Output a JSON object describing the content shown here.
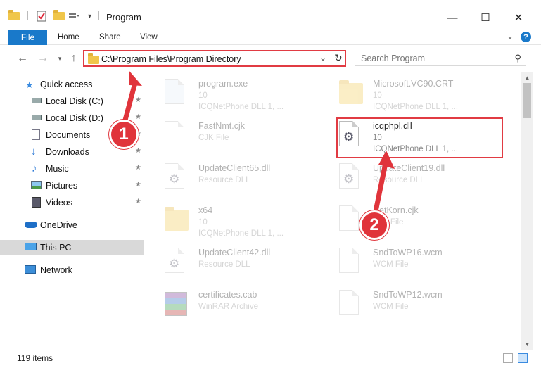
{
  "window": {
    "title": "Program",
    "minimize": "—",
    "maximize": "☐",
    "close": "✕"
  },
  "ribbon": {
    "file": "File",
    "tabs": [
      "Home",
      "Share",
      "View"
    ],
    "help": "?"
  },
  "address": {
    "path": "C:\\Program Files\\Program Directory",
    "search_placeholder": "Search Program"
  },
  "nav": {
    "items": [
      {
        "label": "Quick access",
        "icon": "star-icon",
        "pinned": false
      },
      {
        "label": "Local Disk (C:)",
        "icon": "drive-icon",
        "pinned": true
      },
      {
        "label": "Local Disk (D:)",
        "icon": "drive-icon",
        "pinned": true
      },
      {
        "label": "Documents",
        "icon": "documents-icon",
        "pinned": true
      },
      {
        "label": "Downloads",
        "icon": "download-icon",
        "pinned": true
      },
      {
        "label": "Music",
        "icon": "music-icon",
        "pinned": true
      },
      {
        "label": "Pictures",
        "icon": "pictures-icon",
        "pinned": true
      },
      {
        "label": "Videos",
        "icon": "videos-icon",
        "pinned": true
      },
      {
        "label": "OneDrive",
        "icon": "cloud-icon",
        "pinned": false
      },
      {
        "label": "This PC",
        "icon": "computer-icon",
        "pinned": false
      },
      {
        "label": "Network",
        "icon": "network-icon",
        "pinned": false
      }
    ]
  },
  "files": [
    {
      "name": "program.exe",
      "line2": "10",
      "line3": "ICQNetPhone DLL 1, ...",
      "type": "exe"
    },
    {
      "name": "Microsoft.VC90.CRT",
      "line2": "10",
      "line3": "ICQNetPhone DLL 1, ...",
      "type": "folder"
    },
    {
      "name": "FastNmt.cjk",
      "line2": "CJK File",
      "line3": "",
      "type": "doc"
    },
    {
      "name": "icqphpl.dll",
      "line2": "10",
      "line3": "ICQNetPhone DLL 1, ...",
      "type": "dll"
    },
    {
      "name": "UpdateClient65.dll",
      "line2": "Resource DLL",
      "line3": "",
      "type": "dll"
    },
    {
      "name": "UpdateClient19.dll",
      "line2": "Resource DLL",
      "line3": "",
      "type": "dll"
    },
    {
      "name": "x64",
      "line2": "10",
      "line3": "ICQNetPhone DLL 1, ...",
      "type": "folder"
    },
    {
      "name": "NetKorn.cjk",
      "line2": "CJK File",
      "line3": "",
      "type": "doc"
    },
    {
      "name": "UpdateClient42.dll",
      "line2": "Resource DLL",
      "line3": "",
      "type": "dll"
    },
    {
      "name": "SndToWP16.wcm",
      "line2": "WCM File",
      "line3": "",
      "type": "doc"
    },
    {
      "name": "certificates.cab",
      "line2": "WinRAR Archive",
      "line3": "",
      "type": "winrar"
    },
    {
      "name": "SndToWP12.wcm",
      "line2": "WCM File",
      "line3": "",
      "type": "doc"
    }
  ],
  "status": {
    "count": "119 items"
  },
  "annotations": {
    "step1": "1",
    "step2": "2"
  },
  "colors": {
    "accent": "#1979ca",
    "highlight": "#e13b43",
    "folder": "#f3cd5c"
  }
}
